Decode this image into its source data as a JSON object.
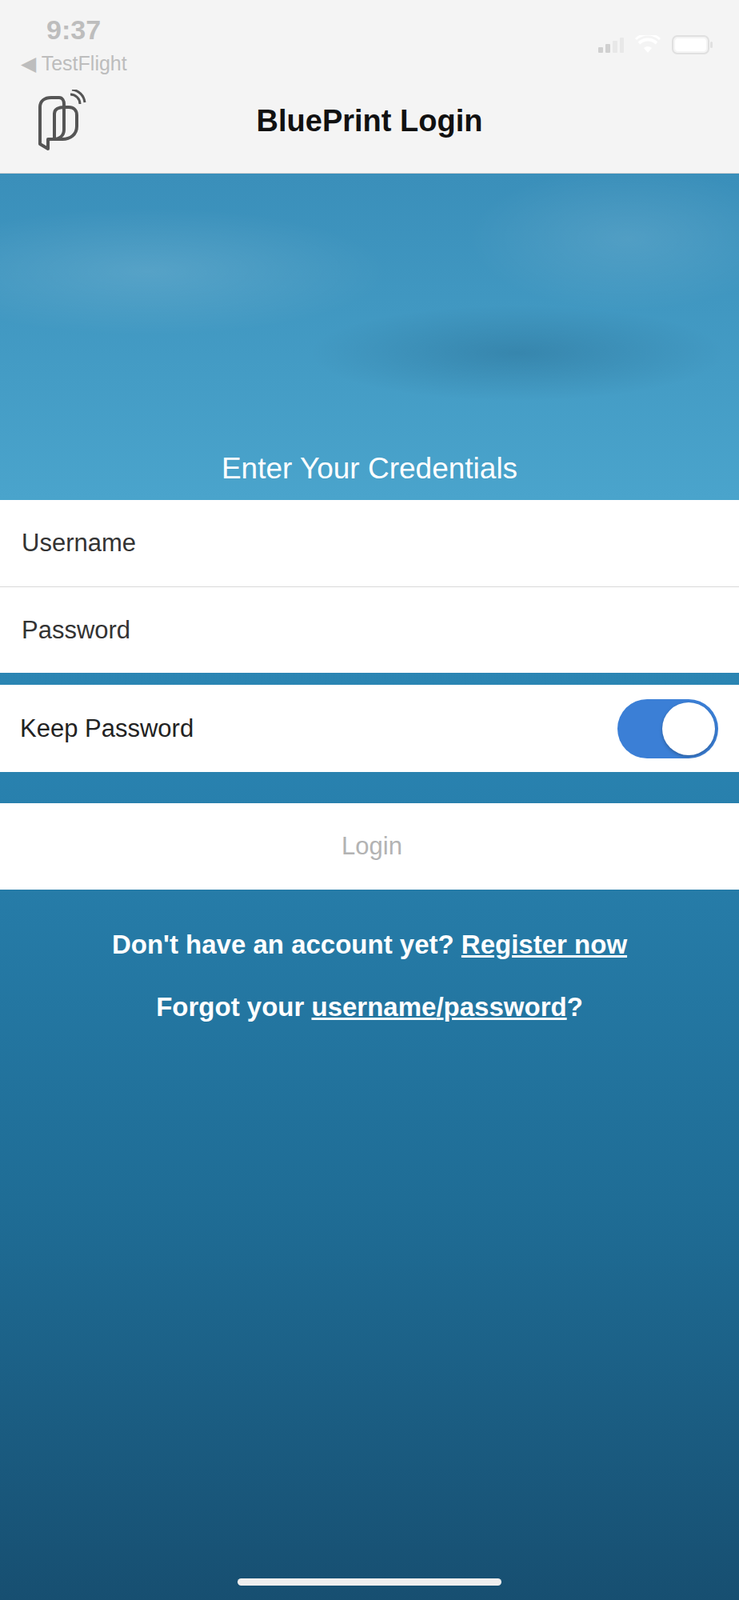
{
  "status_bar": {
    "time": "9:37",
    "back": "◀ TestFlight"
  },
  "header": {
    "title": "BluePrint Login"
  },
  "hero": {
    "heading": "Enter Your Credentials"
  },
  "fields": [
    {
      "placeholder": "Username"
    },
    {
      "placeholder": "Password"
    }
  ],
  "keep_password": {
    "label": "Keep Password",
    "on": true
  },
  "login_button": {
    "label": "Login",
    "disabled": true
  },
  "register": {
    "prompt": "Don't have an account yet?",
    "link": "Register now"
  },
  "forgot": {
    "prefix": "Forgot your",
    "links": [
      "username",
      "password"
    ],
    "separator": "/",
    "suffix": "?"
  }
}
